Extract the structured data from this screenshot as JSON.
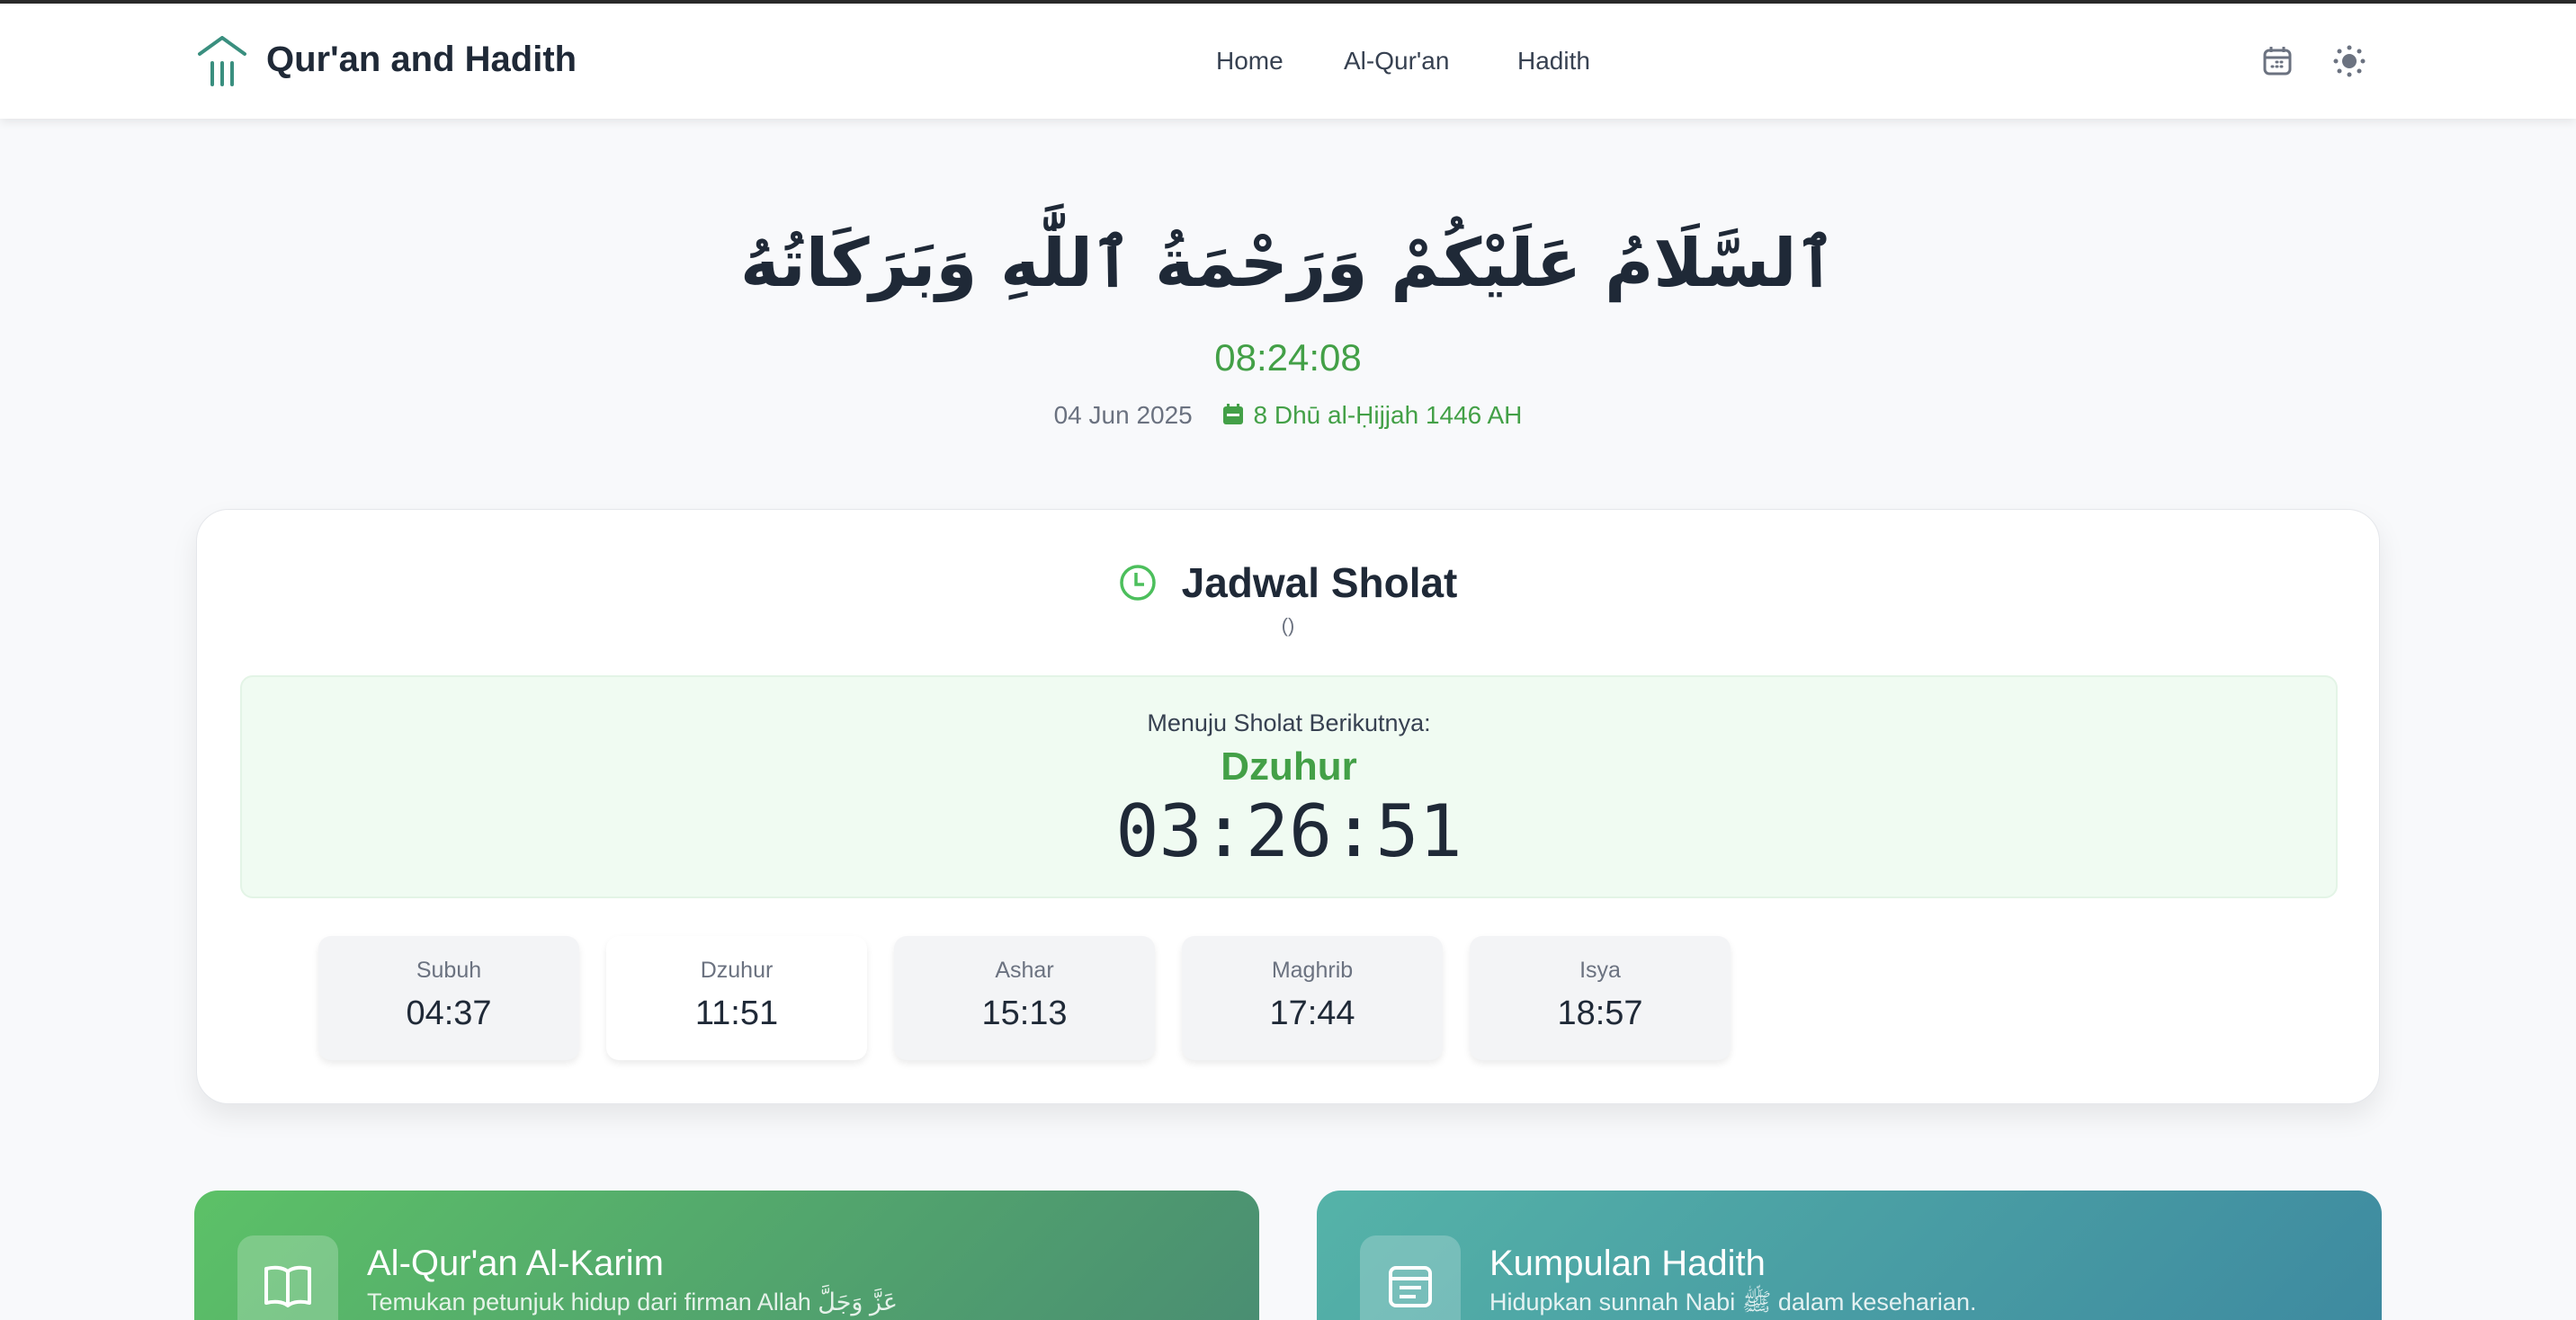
{
  "header": {
    "brand": "Qur'an and Hadith",
    "nav": [
      "Home",
      "Al-Qur'an",
      "Hadith"
    ],
    "icons": [
      "calendar-icon",
      "sun-icon"
    ]
  },
  "hero": {
    "greeting": "ٱلسَّلَامُ عَلَيْكُمْ وَرَحْمَةُ ٱللَّٰهِ وَبَرَكَاتُهُ",
    "clock": "08:24:08",
    "date": "04 Jun 2025",
    "hijri": "8 Dhū al-Ḥijjah 1446 AH"
  },
  "schedule": {
    "title": "Jadwal Sholat",
    "location": "()",
    "next_label": "Menuju Sholat Berikutnya:",
    "next_name": "Dzuhur",
    "countdown": "03:26:51",
    "prayers": [
      {
        "name": "Subuh",
        "time": "04:37"
      },
      {
        "name": "Dzuhur",
        "time": "11:51",
        "active": true
      },
      {
        "name": "Ashar",
        "time": "15:13"
      },
      {
        "name": "Maghrib",
        "time": "17:44"
      },
      {
        "name": "Isya",
        "time": "18:57"
      }
    ]
  },
  "features": [
    {
      "title": "Al-Qur'an Al-Karim",
      "subtitle": "Temukan petunjuk hidup dari firman Allah عَزَّ وَجَلَّ"
    },
    {
      "title": "Kumpulan Hadith",
      "subtitle": "Hidupkan sunnah Nabi ﷺ dalam keseharian."
    }
  ],
  "colors": {
    "accent": "#43a047",
    "logo": "#3a8f7f"
  }
}
